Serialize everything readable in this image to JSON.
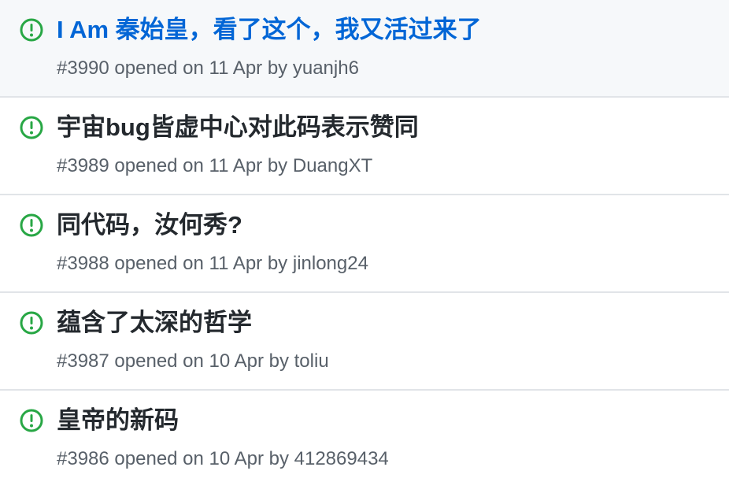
{
  "issues": [
    {
      "title": "I Am 秦始皇，看了这个，我又活过来了",
      "number": "#3990",
      "opened_text": "opened on",
      "date": "11 Apr",
      "by_text": "by",
      "author": "yuanjh6",
      "state_icon": "issue-opened-icon"
    },
    {
      "title": "宇宙bug皆虚中心对此码表示赞同",
      "number": "#3989",
      "opened_text": "opened on",
      "date": "11 Apr",
      "by_text": "by",
      "author": "DuangXT",
      "state_icon": "issue-opened-icon"
    },
    {
      "title": "同代码，汝何秀?",
      "number": "#3988",
      "opened_text": "opened on",
      "date": "11 Apr",
      "by_text": "by",
      "author": "jinlong24",
      "state_icon": "issue-opened-icon"
    },
    {
      "title": "蕴含了太深的哲学",
      "number": "#3987",
      "opened_text": "opened on",
      "date": "10 Apr",
      "by_text": "by",
      "author": "toliu",
      "state_icon": "issue-opened-icon"
    },
    {
      "title": "皇帝的新码",
      "number": "#3986",
      "opened_text": "opened on",
      "date": "10 Apr",
      "by_text": "by",
      "author": "412869434",
      "state_icon": "issue-opened-icon"
    }
  ],
  "colors": {
    "open_icon": "#28a745",
    "title": "#24292e",
    "title_active": "#0366d6",
    "meta": "#586069",
    "highlight_bg": "#f6f8fa",
    "divider": "#e1e4e8"
  }
}
